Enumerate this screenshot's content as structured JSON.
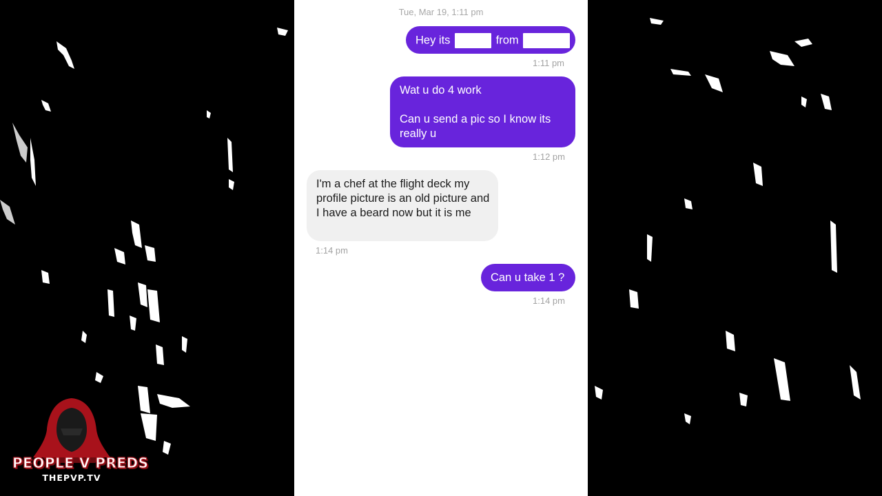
{
  "conversation": {
    "date_header": "Tue, Mar 19, 1:11 pm",
    "messages": [
      {
        "direction": "outgoing",
        "parts": [
          "Hey its",
          "from"
        ],
        "redacted": true,
        "time": "1:11 pm"
      },
      {
        "direction": "outgoing",
        "paragraphs": [
          "Wat u do 4 work",
          "Can u send a pic so I know its really u"
        ],
        "time": "1:12 pm"
      },
      {
        "direction": "incoming",
        "text": "I'm a chef at the flight deck my profile picture is an old picture and I have a beard now but it is me",
        "time": "1:14 pm"
      },
      {
        "direction": "outgoing",
        "text": "Can u take 1 ?",
        "time": "1:14 pm"
      }
    ]
  },
  "branding": {
    "title": "PEOPLE V PREDS",
    "subtitle": "THEPVP.TV"
  },
  "colors": {
    "outgoing_bubble": "#6824dc",
    "incoming_bubble": "#f0f0f0",
    "background": "#000000",
    "brand_red": "#b01620"
  },
  "icons": {
    "logo": "hooded-figure-icon"
  }
}
